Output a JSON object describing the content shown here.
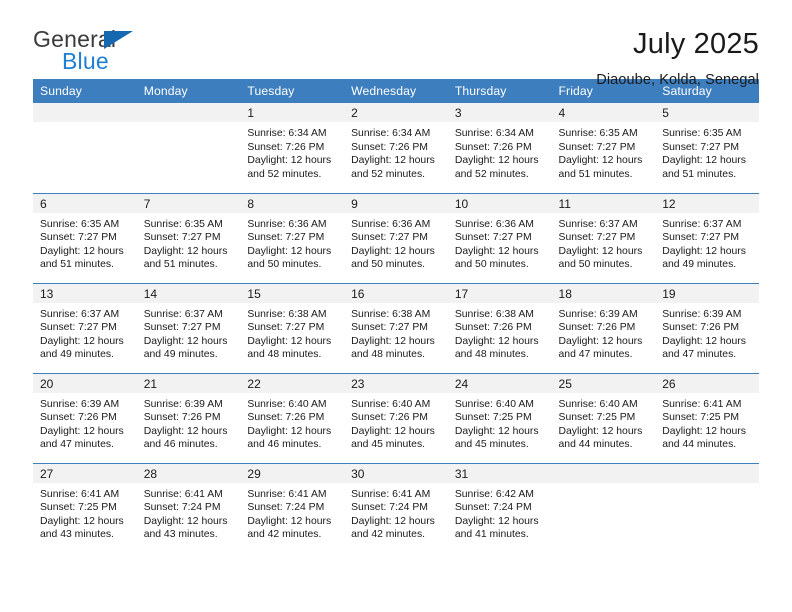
{
  "brand": {
    "name_top": "General",
    "name_bottom": "Blue",
    "triangle_color": "#1567b0",
    "blue_text_color": "#1f7fd0"
  },
  "header": {
    "title": "July 2025",
    "subtitle": "Diaoube, Kolda, Senegal"
  },
  "theme": {
    "header_blue": "#3d7ebf",
    "daynum_band": "#f2f2f2",
    "text": "#1a1a1a"
  },
  "weekdays": [
    "Sunday",
    "Monday",
    "Tuesday",
    "Wednesday",
    "Thursday",
    "Friday",
    "Saturday"
  ],
  "labels": {
    "sunrise_prefix": "Sunrise:",
    "sunset_prefix": "Sunset:",
    "daylight_prefix": "Daylight:"
  },
  "weeks": [
    [
      {
        "day": "",
        "empty": true
      },
      {
        "day": "",
        "empty": true
      },
      {
        "day": "1",
        "sunrise": "Sunrise: 6:34 AM",
        "sunset": "Sunset: 7:26 PM",
        "daylight_1": "Daylight: 12 hours",
        "daylight_2": "and 52 minutes."
      },
      {
        "day": "2",
        "sunrise": "Sunrise: 6:34 AM",
        "sunset": "Sunset: 7:26 PM",
        "daylight_1": "Daylight: 12 hours",
        "daylight_2": "and 52 minutes."
      },
      {
        "day": "3",
        "sunrise": "Sunrise: 6:34 AM",
        "sunset": "Sunset: 7:26 PM",
        "daylight_1": "Daylight: 12 hours",
        "daylight_2": "and 52 minutes."
      },
      {
        "day": "4",
        "sunrise": "Sunrise: 6:35 AM",
        "sunset": "Sunset: 7:27 PM",
        "daylight_1": "Daylight: 12 hours",
        "daylight_2": "and 51 minutes."
      },
      {
        "day": "5",
        "sunrise": "Sunrise: 6:35 AM",
        "sunset": "Sunset: 7:27 PM",
        "daylight_1": "Daylight: 12 hours",
        "daylight_2": "and 51 minutes."
      }
    ],
    [
      {
        "day": "6",
        "sunrise": "Sunrise: 6:35 AM",
        "sunset": "Sunset: 7:27 PM",
        "daylight_1": "Daylight: 12 hours",
        "daylight_2": "and 51 minutes."
      },
      {
        "day": "7",
        "sunrise": "Sunrise: 6:35 AM",
        "sunset": "Sunset: 7:27 PM",
        "daylight_1": "Daylight: 12 hours",
        "daylight_2": "and 51 minutes."
      },
      {
        "day": "8",
        "sunrise": "Sunrise: 6:36 AM",
        "sunset": "Sunset: 7:27 PM",
        "daylight_1": "Daylight: 12 hours",
        "daylight_2": "and 50 minutes."
      },
      {
        "day": "9",
        "sunrise": "Sunrise: 6:36 AM",
        "sunset": "Sunset: 7:27 PM",
        "daylight_1": "Daylight: 12 hours",
        "daylight_2": "and 50 minutes."
      },
      {
        "day": "10",
        "sunrise": "Sunrise: 6:36 AM",
        "sunset": "Sunset: 7:27 PM",
        "daylight_1": "Daylight: 12 hours",
        "daylight_2": "and 50 minutes."
      },
      {
        "day": "11",
        "sunrise": "Sunrise: 6:37 AM",
        "sunset": "Sunset: 7:27 PM",
        "daylight_1": "Daylight: 12 hours",
        "daylight_2": "and 50 minutes."
      },
      {
        "day": "12",
        "sunrise": "Sunrise: 6:37 AM",
        "sunset": "Sunset: 7:27 PM",
        "daylight_1": "Daylight: 12 hours",
        "daylight_2": "and 49 minutes."
      }
    ],
    [
      {
        "day": "13",
        "sunrise": "Sunrise: 6:37 AM",
        "sunset": "Sunset: 7:27 PM",
        "daylight_1": "Daylight: 12 hours",
        "daylight_2": "and 49 minutes."
      },
      {
        "day": "14",
        "sunrise": "Sunrise: 6:37 AM",
        "sunset": "Sunset: 7:27 PM",
        "daylight_1": "Daylight: 12 hours",
        "daylight_2": "and 49 minutes."
      },
      {
        "day": "15",
        "sunrise": "Sunrise: 6:38 AM",
        "sunset": "Sunset: 7:27 PM",
        "daylight_1": "Daylight: 12 hours",
        "daylight_2": "and 48 minutes."
      },
      {
        "day": "16",
        "sunrise": "Sunrise: 6:38 AM",
        "sunset": "Sunset: 7:27 PM",
        "daylight_1": "Daylight: 12 hours",
        "daylight_2": "and 48 minutes."
      },
      {
        "day": "17",
        "sunrise": "Sunrise: 6:38 AM",
        "sunset": "Sunset: 7:26 PM",
        "daylight_1": "Daylight: 12 hours",
        "daylight_2": "and 48 minutes."
      },
      {
        "day": "18",
        "sunrise": "Sunrise: 6:39 AM",
        "sunset": "Sunset: 7:26 PM",
        "daylight_1": "Daylight: 12 hours",
        "daylight_2": "and 47 minutes."
      },
      {
        "day": "19",
        "sunrise": "Sunrise: 6:39 AM",
        "sunset": "Sunset: 7:26 PM",
        "daylight_1": "Daylight: 12 hours",
        "daylight_2": "and 47 minutes."
      }
    ],
    [
      {
        "day": "20",
        "sunrise": "Sunrise: 6:39 AM",
        "sunset": "Sunset: 7:26 PM",
        "daylight_1": "Daylight: 12 hours",
        "daylight_2": "and 47 minutes."
      },
      {
        "day": "21",
        "sunrise": "Sunrise: 6:39 AM",
        "sunset": "Sunset: 7:26 PM",
        "daylight_1": "Daylight: 12 hours",
        "daylight_2": "and 46 minutes."
      },
      {
        "day": "22",
        "sunrise": "Sunrise: 6:40 AM",
        "sunset": "Sunset: 7:26 PM",
        "daylight_1": "Daylight: 12 hours",
        "daylight_2": "and 46 minutes."
      },
      {
        "day": "23",
        "sunrise": "Sunrise: 6:40 AM",
        "sunset": "Sunset: 7:26 PM",
        "daylight_1": "Daylight: 12 hours",
        "daylight_2": "and 45 minutes."
      },
      {
        "day": "24",
        "sunrise": "Sunrise: 6:40 AM",
        "sunset": "Sunset: 7:25 PM",
        "daylight_1": "Daylight: 12 hours",
        "daylight_2": "and 45 minutes."
      },
      {
        "day": "25",
        "sunrise": "Sunrise: 6:40 AM",
        "sunset": "Sunset: 7:25 PM",
        "daylight_1": "Daylight: 12 hours",
        "daylight_2": "and 44 minutes."
      },
      {
        "day": "26",
        "sunrise": "Sunrise: 6:41 AM",
        "sunset": "Sunset: 7:25 PM",
        "daylight_1": "Daylight: 12 hours",
        "daylight_2": "and 44 minutes."
      }
    ],
    [
      {
        "day": "27",
        "sunrise": "Sunrise: 6:41 AM",
        "sunset": "Sunset: 7:25 PM",
        "daylight_1": "Daylight: 12 hours",
        "daylight_2": "and 43 minutes."
      },
      {
        "day": "28",
        "sunrise": "Sunrise: 6:41 AM",
        "sunset": "Sunset: 7:24 PM",
        "daylight_1": "Daylight: 12 hours",
        "daylight_2": "and 43 minutes."
      },
      {
        "day": "29",
        "sunrise": "Sunrise: 6:41 AM",
        "sunset": "Sunset: 7:24 PM",
        "daylight_1": "Daylight: 12 hours",
        "daylight_2": "and 42 minutes."
      },
      {
        "day": "30",
        "sunrise": "Sunrise: 6:41 AM",
        "sunset": "Sunset: 7:24 PM",
        "daylight_1": "Daylight: 12 hours",
        "daylight_2": "and 42 minutes."
      },
      {
        "day": "31",
        "sunrise": "Sunrise: 6:42 AM",
        "sunset": "Sunset: 7:24 PM",
        "daylight_1": "Daylight: 12 hours",
        "daylight_2": "and 41 minutes."
      },
      {
        "day": "",
        "empty": true
      },
      {
        "day": "",
        "empty": true
      }
    ]
  ]
}
